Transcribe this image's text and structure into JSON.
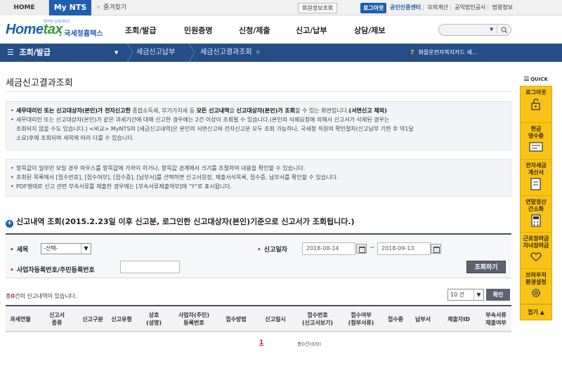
{
  "util": {
    "home": "HOME",
    "mynts": "My NTS",
    "favorite": "즐겨찾기",
    "member_info": "회원정보조회",
    "logout": "로그아웃",
    "links": [
      "공인인증센터",
      "모의계산",
      "공익법인공시",
      "법령정보"
    ]
  },
  "header": {
    "logo_sub": "전자한 납세서비스",
    "logo_main_a": "Home",
    "logo_main_b": "tax",
    "logo_kr": ". 국세청홈택스",
    "gnb": [
      "조회/발급",
      "민원증명",
      "신청/제출",
      "신고/납부",
      "상담/제보"
    ]
  },
  "navbar": {
    "menu": "조회/발급",
    "crumb1": "세금신고납부",
    "crumb2": "세금신고결과조회",
    "notice_num": "7",
    "notice_text": "화물운전자복지카드 세..."
  },
  "page": {
    "title": "세금신고결과조회",
    "info1": {
      "l1_a": "세무대리인 또는 신고대상자(본인)가 전자신고한",
      "l1_b": " 종합소득세, 부가가치세 등 ",
      "l1_c": "모든 신고내역",
      "l1_d": "을 ",
      "l1_e": "신고대상자(본인)가 조회",
      "l1_f": "할 수 있는 화면입니다.",
      "l1_g": "(서면신고 제외)",
      "l2": "세무대리인 또는 신고대상자(본인)가 같은 과세기간에 대해 신고한 경우에는 2건 이상이 조회될 수 있습니다.(본인의 삭제요청에 의해서 신고서가 삭제된 경우는",
      "l3": "조회되지 않을 수도 있습니다.) <비교> MyNTS의 [세금신고내역]은 본인의 서면신고와 전자신고분 모두 조회 가능하나, 국세청 직원의 확인절차(신고납부 기한 후 약1달",
      "l4": "소요)후에 조회되며 세목에 따라 다를 수 있습니다."
    },
    "info2": [
      "항목값이 일부만 보일 경우 마우스를 항목값에 가까이 하거나, 항목값 경계에서 크기를 조절하여 내용을 확인할 수 있습니다.",
      "조회된 목록에서 [접수번호], [접수여부], [접수증], [납부서]를 선택하면 신고서원장, 제출서식목록, 접수증, 납부서를 확인할 수 있습니다.",
      "PDF형태로 신고 관련 부속서류를 제출한 경우에는 [부속서류제출여부]에 \"Y\"로  표시됩니다."
    ],
    "section_title": "신고내역 조회(2015.2.23일 이후 신고분, 로그인한  신고대상자(본인)기준으로  신고서가 조회됩니다.)",
    "form": {
      "tax_label": "세목",
      "tax_value": "-선택-",
      "date_label": "신고일자",
      "date_from": "2018-08-14",
      "date_to": "2018-09-13",
      "tilde": "~",
      "regno_label": "사업자등록번호/주민등록번호",
      "regno_value": "",
      "search_button": "조회하기"
    },
    "count": {
      "prefix": "총",
      "n": "0",
      "suffix": "건의 신고내역이 있습니다."
    },
    "rows_value": "10 건",
    "ok_button": "확인",
    "table_headers": [
      "과세연월",
      "신고서\n종류",
      "신고구분",
      "신고유형",
      "상호\n(성명)",
      "사업자(주민)\n등록번호",
      "접수방법",
      "신고일시",
      "접수번호\n(신고서보기)",
      "접수여부\n(첨부서류)",
      "접수증",
      "납부서",
      "제출자ID",
      "부속서류\n제출여부"
    ],
    "pager": "1",
    "total": "총0건(0/0)"
  },
  "quick": {
    "title": "QUICK",
    "items": [
      "로그아웃",
      "현금\n영수증",
      "전자세금\n계산서",
      "연말정산\n간소화",
      "근로장려금\n자녀장려금",
      "브라우저\n환경설정"
    ],
    "close": "접기"
  },
  "colors": {
    "brand": "#1f5fae",
    "nav": "#264d88",
    "quick": "#f8c318",
    "required": "#d6282a"
  }
}
